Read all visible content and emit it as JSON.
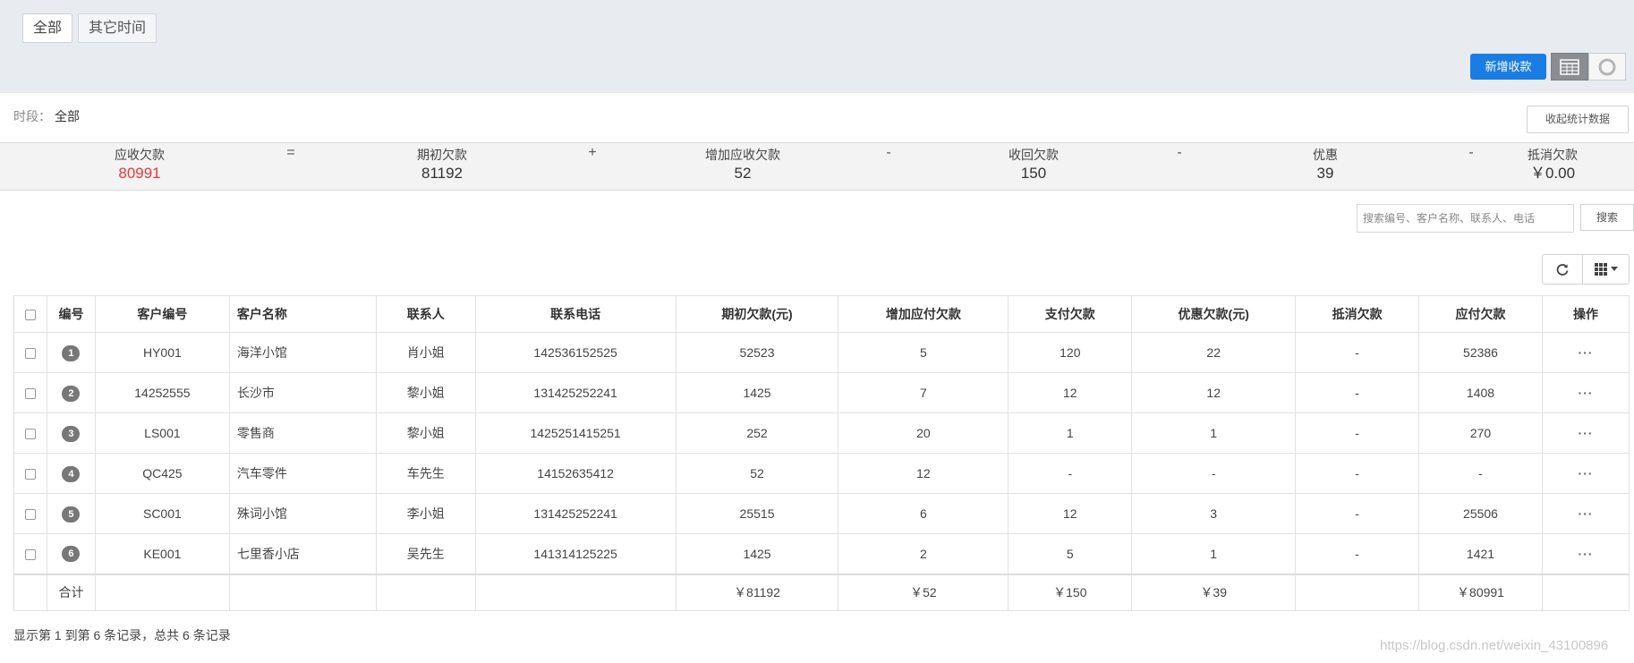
{
  "tabs": [
    "全部",
    "其它时间"
  ],
  "toolbar": {
    "new_label": "新增收款",
    "collapse_label": "收起统计数据"
  },
  "period": {
    "label": "时段：",
    "value": "全部"
  },
  "stats": [
    {
      "label": "应收欠款",
      "value": "80991"
    },
    {
      "label": "期初欠款",
      "value": "81192"
    },
    {
      "label": "增加应收欠款",
      "value": "52"
    },
    {
      "label": "收回欠款",
      "value": "150"
    },
    {
      "label": "优惠",
      "value": "39"
    },
    {
      "label": "抵消欠款",
      "value": "￥0.00"
    }
  ],
  "operators": [
    "=",
    "+",
    "-",
    "-",
    "-"
  ],
  "search": {
    "placeholder": "搜索编号、客户名称、联系人、电话",
    "button_label": "搜索"
  },
  "table": {
    "headers": [
      "编号",
      "客户编号",
      "客户名称",
      "联系人",
      "联系电话",
      "期初欠款(元)",
      "增加应付欠款",
      "支付欠款",
      "优惠欠款(元)",
      "抵消欠款",
      "应付欠款",
      "操作"
    ],
    "rows": [
      {
        "no": "1",
        "code": "HY001",
        "name": "海洋小馆",
        "contact": "肖小姐",
        "phone": "142536152525",
        "opening": "52523",
        "added": "5",
        "paid": "120",
        "discount": "22",
        "offset": "-",
        "payable": "52386",
        "action": "···"
      },
      {
        "no": "2",
        "code": "14252555",
        "name": "长沙市",
        "contact": "黎小姐",
        "phone": "131425252241",
        "opening": "1425",
        "added": "7",
        "paid": "12",
        "discount": "12",
        "offset": "-",
        "payable": "1408",
        "action": "···"
      },
      {
        "no": "3",
        "code": "LS001",
        "name": "零售商",
        "contact": "黎小姐",
        "phone": "1425251415251",
        "opening": "252",
        "added": "20",
        "paid": "1",
        "discount": "1",
        "offset": "-",
        "payable": "270",
        "action": "···"
      },
      {
        "no": "4",
        "code": "QC425",
        "name": "汽车零件",
        "contact": "车先生",
        "phone": "14152635412",
        "opening": "52",
        "added": "12",
        "paid": "-",
        "discount": "-",
        "offset": "-",
        "payable": "-",
        "action": "···"
      },
      {
        "no": "5",
        "code": "SC001",
        "name": "殊词小馆",
        "contact": "李小姐",
        "phone": "131425252241",
        "opening": "25515",
        "added": "6",
        "paid": "12",
        "discount": "3",
        "offset": "-",
        "payable": "25506",
        "action": "···"
      },
      {
        "no": "6",
        "code": "KE001",
        "name": "七里香小店",
        "contact": "吴先生",
        "phone": "141314125225",
        "opening": "1425",
        "added": "2",
        "paid": "5",
        "discount": "1",
        "offset": "-",
        "payable": "1421",
        "action": "···"
      }
    ],
    "total": {
      "label": "合计",
      "opening": "￥81192",
      "added": "￥52",
      "paid": "￥150",
      "discount": "￥39",
      "payable": "￥80991"
    }
  },
  "footer": "显示第 1 到第 6 条记录，总共 6 条记录",
  "watermark": "https://blog.csdn.net/weixin_43100896",
  "colors": {
    "primary": "#1a7de3",
    "accent_red": "#e4393c",
    "band": "#e8ebef"
  }
}
